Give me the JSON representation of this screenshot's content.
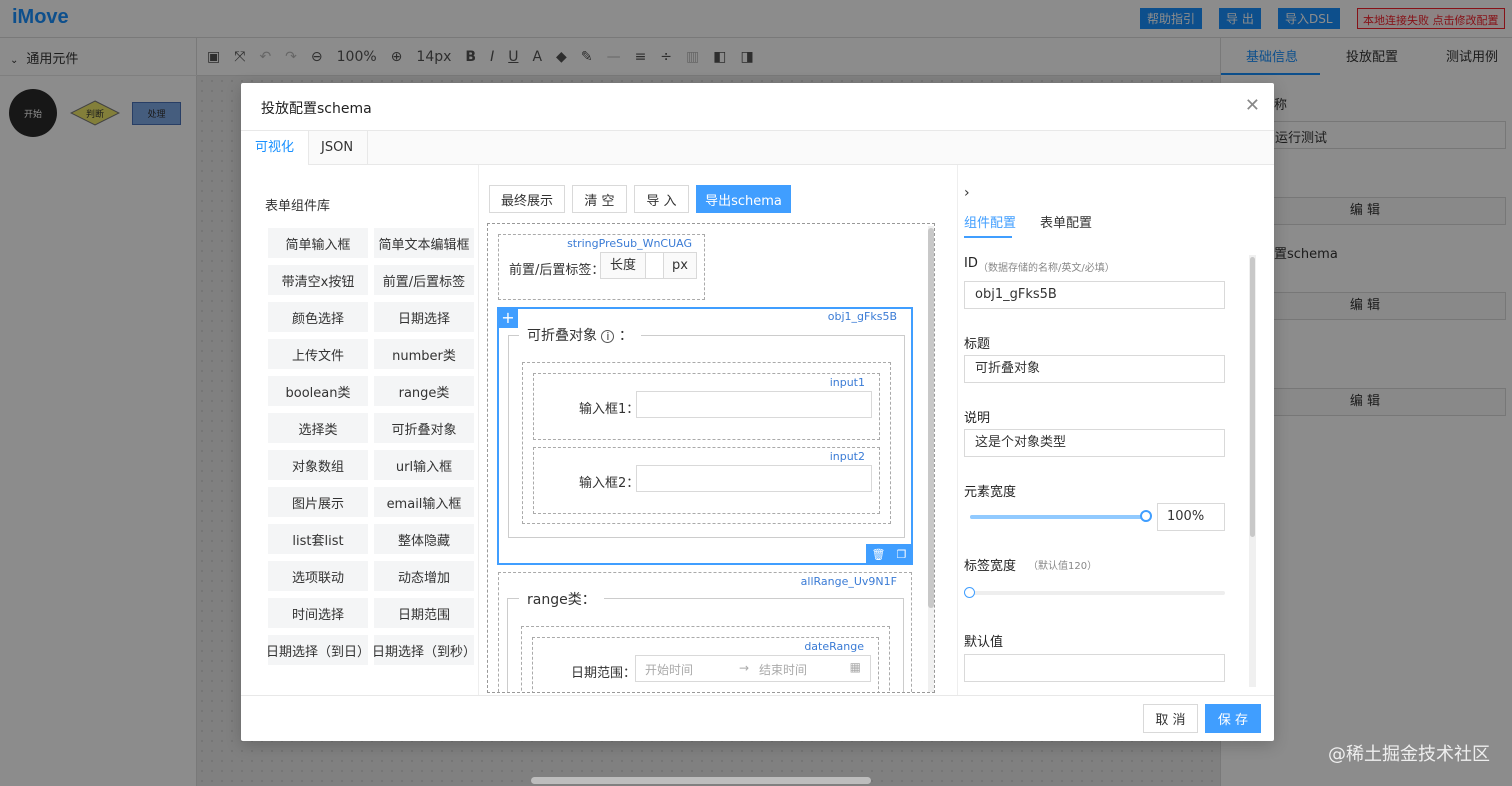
{
  "app": {
    "logo": "iMove",
    "top_buttons": [
      "帮助指引",
      "导 出",
      "导入DSL"
    ],
    "status_badge": "本地连接失败 点击修改配置"
  },
  "left_panel": {
    "section": "通用元件",
    "nodes": [
      "开始",
      "判断",
      "处理"
    ]
  },
  "toolbar": {
    "zoom": "100%",
    "font_size": "14px"
  },
  "right_panel": {
    "tabs": [
      "基础信息",
      "投放配置",
      "测试用例"
    ],
    "name_label": "称",
    "name_value": "运行测试",
    "schema_label": "置schema",
    "edit_label": "编 辑"
  },
  "modal": {
    "title": "投放配置schema",
    "tabs": [
      "可视化",
      "JSON"
    ],
    "library": {
      "title": "表单组件库",
      "items": [
        "简单输入框",
        "简单文本编辑框",
        "带清空x按钮",
        "前置/后置标签",
        "颜色选择",
        "日期选择",
        "上传文件",
        "number类",
        "boolean类",
        "range类",
        "选择类",
        "可折叠对象",
        "对象数组",
        "url输入框",
        "图片展示",
        "email输入框",
        "list套list",
        "整体隐藏",
        "选项联动",
        "动态增加",
        "时间选择",
        "日期范围",
        "日期选择（到日）",
        "日期选择（到秒）"
      ]
    },
    "center": {
      "buttons": [
        "最终展示",
        "清 空",
        "导 入",
        "导出schema"
      ],
      "prefix_block": {
        "id": "stringPreSub_WnCUAG",
        "label": "前置/后置标签：",
        "prefix": "长度",
        "suffix": "px"
      },
      "object_block": {
        "id": "obj1_gFks5B",
        "title": "可折叠对象",
        "fields": [
          {
            "id": "input1",
            "label": "输入框1："
          },
          {
            "id": "input2",
            "label": "输入框2："
          }
        ]
      },
      "range_block": {
        "id": "allRange_Uv9N1F",
        "title": "range类：",
        "inner_id": "dateRange",
        "label": "日期范围：",
        "start_placeholder": "开始时间",
        "end_placeholder": "结束时间",
        "arrow": "→"
      }
    },
    "props": {
      "tabs": [
        "组件配置",
        "表单配置"
      ],
      "id_label": "ID",
      "id_hint": "（数据存储的名称/英文/必填）",
      "id_value": "obj1_gFks5B",
      "title_label": "标题",
      "title_value": "可折叠对象",
      "desc_label": "说明",
      "desc_value": "这是个对象类型",
      "width_label": "元素宽度",
      "width_value": "100%",
      "width_fraction": 1.0,
      "label_width_label": "标签宽度",
      "label_width_hint": "（默认值120）",
      "label_width_fraction": 0,
      "default_label": "默认值",
      "default_value": ""
    },
    "footer": {
      "cancel": "取 消",
      "save": "保 存"
    }
  },
  "watermark": "@稀土掘金技术社区",
  "colors": {
    "primary": "#409eff",
    "brand": "#1890ff",
    "danger": "#f5222d"
  }
}
